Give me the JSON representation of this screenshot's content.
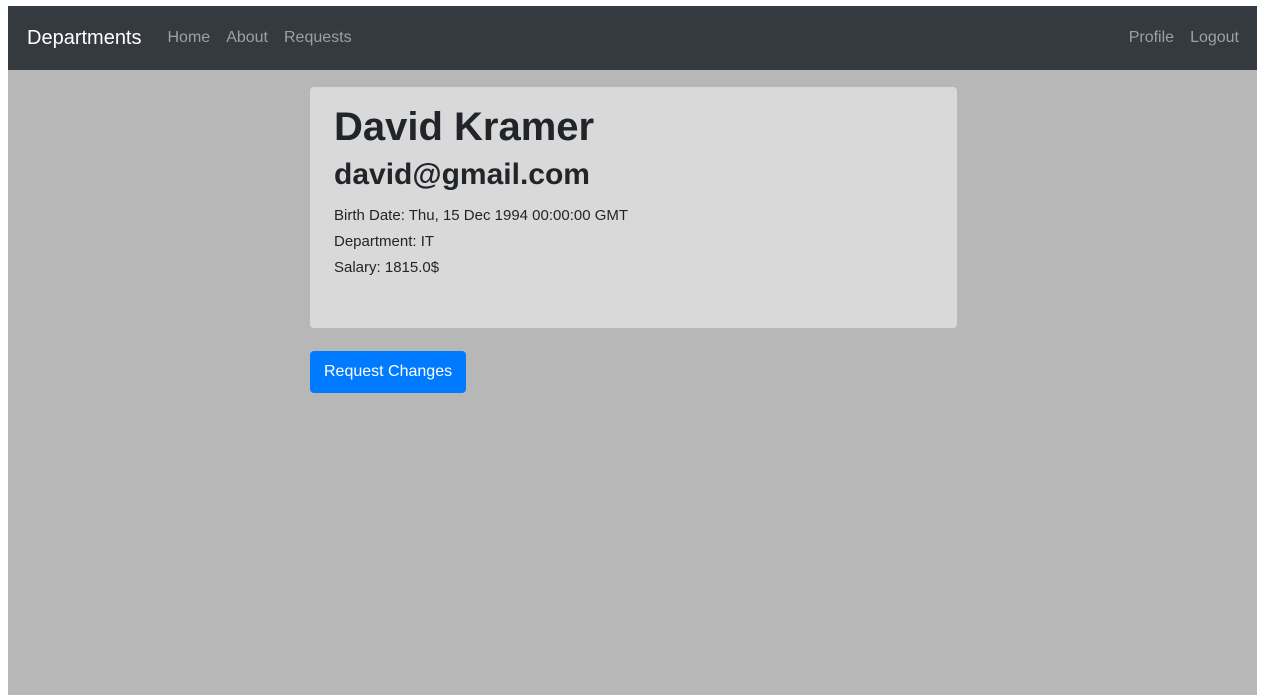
{
  "navbar": {
    "brand": "Departments",
    "links": [
      "Home",
      "About",
      "Requests"
    ],
    "right_links": [
      "Profile",
      "Logout"
    ],
    "colors": {
      "background": "#343a40",
      "brand_text": "#ffffff",
      "link_text": "#9aa0a6"
    }
  },
  "profile": {
    "name": "David Kramer",
    "email": "david@gmail.com",
    "birth_date": "Birth Date: Thu, 15 Dec 1994 00:00:00 GMT",
    "department": "Department: IT",
    "salary": "Salary: 1815.0$"
  },
  "actions": {
    "request_changes_label": "Request Changes"
  },
  "colors": {
    "page_background": "#b7b7b7",
    "card_background": "#d9d9d9",
    "primary_button": "#007bff"
  }
}
